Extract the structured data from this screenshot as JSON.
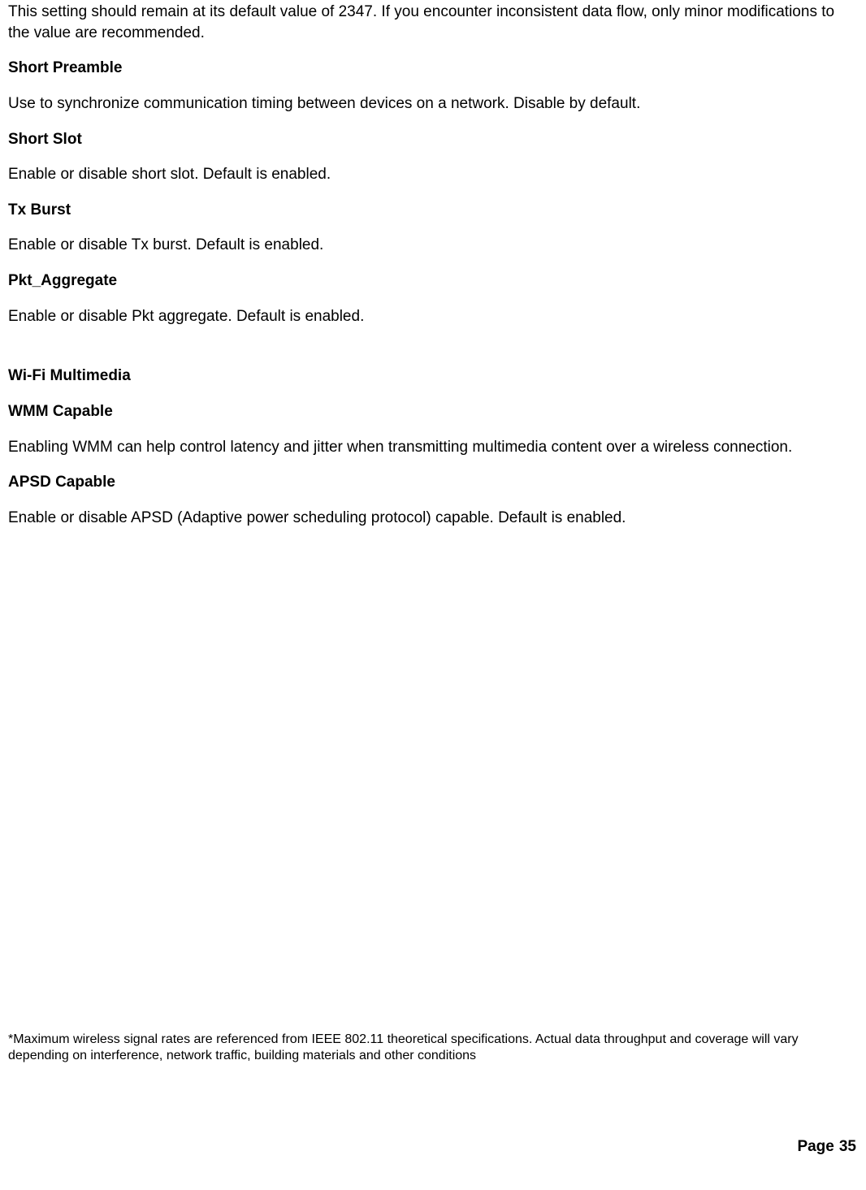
{
  "intro": "This setting should remain at its default value of 2347. If you encounter inconsistent data flow, only minor modifications to the value are recommended.",
  "sections": {
    "short_preamble": {
      "title": "Short Preamble",
      "body": "Use to synchronize communication timing between devices on a network. Disable by default."
    },
    "short_slot": {
      "title": "Short Slot",
      "body": "Enable or disable short slot. Default is enabled."
    },
    "tx_burst": {
      "title": "Tx Burst",
      "body": "Enable or disable Tx burst. Default is enabled."
    },
    "pkt_aggregate": {
      "title": "Pkt_Aggregate",
      "body": "Enable or disable Pkt aggregate. Default is enabled."
    },
    "wifi_multimedia": {
      "title": "Wi-Fi Multimedia"
    },
    "wmm_capable": {
      "title": "WMM Capable",
      "body": "Enabling WMM can help control latency and jitter when transmitting multimedia content over a wireless connection."
    },
    "apsd_capable": {
      "title": "APSD Capable",
      "body": "Enable or disable APSD (Adaptive power scheduling protocol) capable. Default is enabled."
    }
  },
  "footnote": "*Maximum wireless signal rates are referenced from IEEE 802.11 theoretical specifications. Actual data throughput and coverage will vary depending on interference, network traffic, building materials and other conditions",
  "page": {
    "label": "Page",
    "number": "35"
  }
}
